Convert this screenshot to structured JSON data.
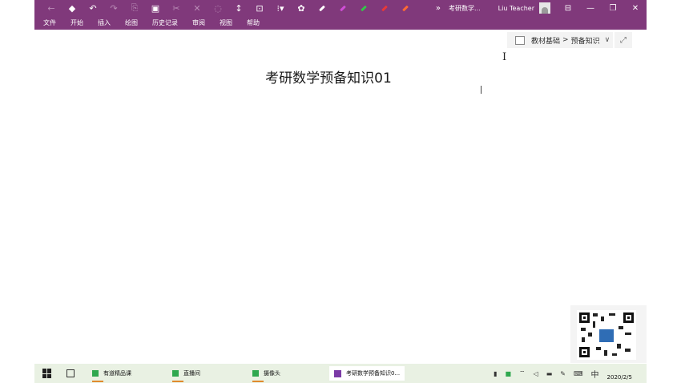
{
  "titlebar": {
    "doc_title": "考研数学...",
    "user_name": "Liu Teacher",
    "overflow": "»",
    "pen_colors": [
      "#ffffff",
      "#d04dd6",
      "#35c44a",
      "#e83838",
      "#ff6a33"
    ]
  },
  "menubar": {
    "items": [
      "文件",
      "开始",
      "插入",
      "绘图",
      "历史记录",
      "审阅",
      "视图",
      "帮助"
    ]
  },
  "breadcrumb": {
    "section": "教材基础",
    "separator": ">",
    "page": "预备知识"
  },
  "page": {
    "title": "考研数学预备知识01"
  },
  "taskbar": {
    "apps": [
      "有道精品课",
      "直播间",
      "摄像头",
      "考研数学预备知识0..."
    ],
    "ime": "中",
    "date": "2020/2/5"
  }
}
